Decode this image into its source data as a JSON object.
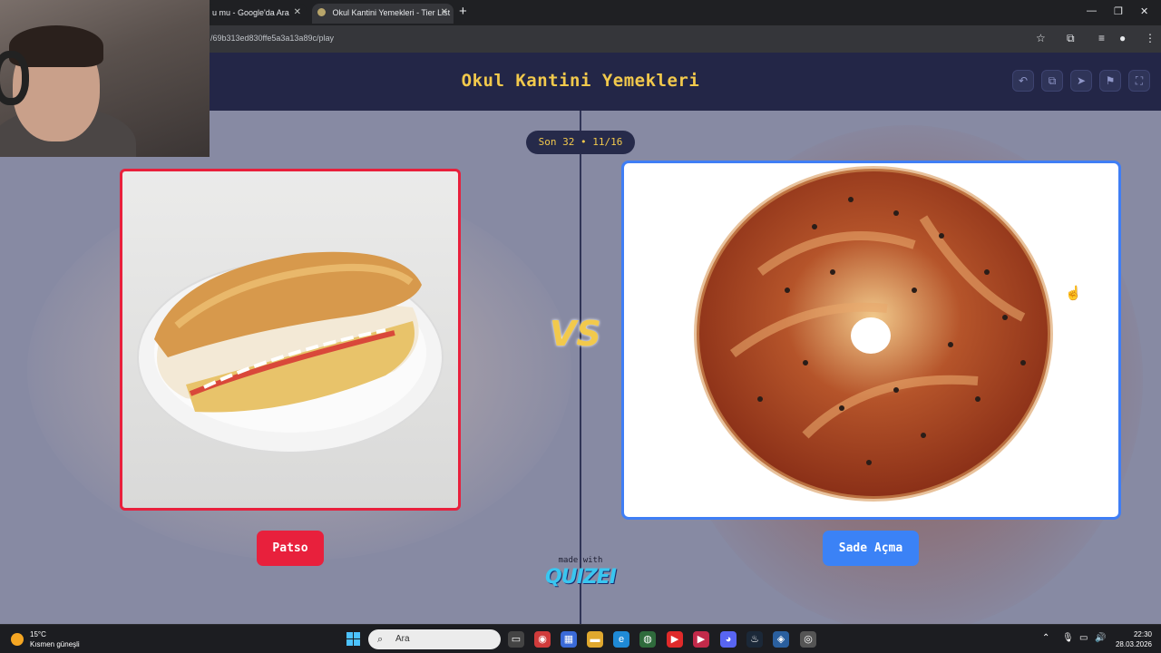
{
  "browser": {
    "tabs": [
      {
        "label": "u mu - Google'da Ara"
      },
      {
        "label": "Okul Kantini Yemekleri - Tier List"
      }
    ],
    "url": "/69b313ed830ffe5a3a13a89c/play",
    "new_tab": "+",
    "window_controls": [
      "—",
      "❐",
      "✕"
    ]
  },
  "app": {
    "title": "Okul Kantini Yemekleri",
    "header_buttons": [
      "undo-icon",
      "copy-icon",
      "send-icon",
      "flag-icon",
      "fullscreen-icon"
    ],
    "round_label": "Son 32 • 11/16",
    "vs_label": "VS",
    "left_option": {
      "label": "Patso",
      "color": "#e8203c"
    },
    "right_option": {
      "label": "Sade Açma",
      "color": "#3b82f6"
    },
    "made_with": "made with",
    "brand": "QUIZEI"
  },
  "taskbar": {
    "weather_temp": "15°C",
    "weather_desc": "Kısmen güneşli",
    "search_placeholder": "Ara",
    "time": "22:30",
    "date": "28.03.2026"
  }
}
